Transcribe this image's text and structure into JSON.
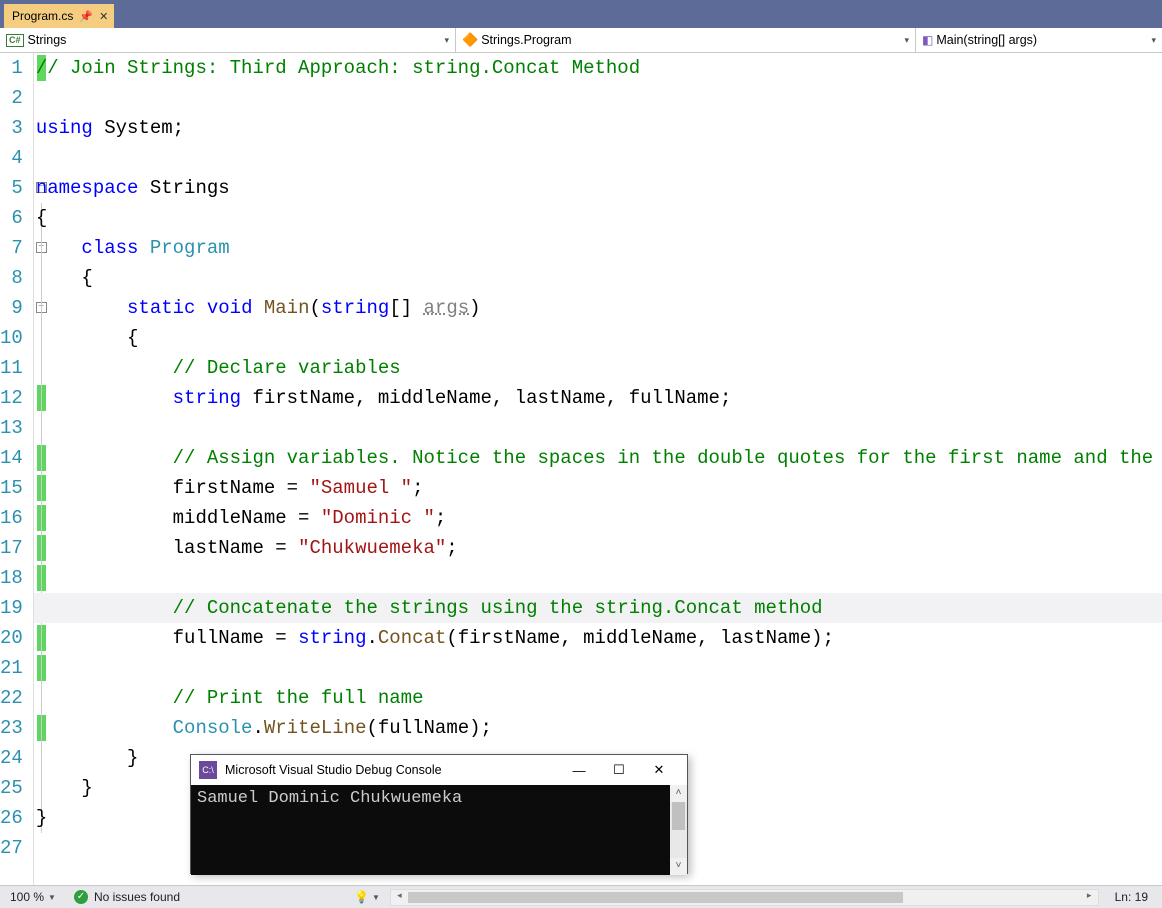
{
  "tab": {
    "name": "Program.cs"
  },
  "nav": {
    "scope": "Strings",
    "class": "Strings.Program",
    "method": "Main(string[] args)"
  },
  "code": {
    "lines": [
      {
        "n": 1,
        "indent": 0,
        "marker": true,
        "tokens": [
          [
            "c-comment",
            "// Join Strings: Third Approach: string.Concat Method"
          ]
        ]
      },
      {
        "n": 2,
        "indent": 0,
        "tokens": []
      },
      {
        "n": 3,
        "indent": 0,
        "tokens": [
          [
            "c-keyword",
            "using"
          ],
          [
            "",
            " System;"
          ]
        ]
      },
      {
        "n": 4,
        "indent": 0,
        "tokens": []
      },
      {
        "n": 5,
        "indent": 0,
        "fold": true,
        "tokens": [
          [
            "c-keyword",
            "namespace"
          ],
          [
            "",
            " Strings"
          ]
        ]
      },
      {
        "n": 6,
        "indent": 0,
        "tokens": [
          [
            "",
            "{"
          ]
        ]
      },
      {
        "n": 7,
        "indent": 1,
        "fold": true,
        "tokens": [
          [
            "c-keyword",
            "class"
          ],
          [
            "",
            " "
          ],
          [
            "c-type",
            "Program"
          ]
        ]
      },
      {
        "n": 8,
        "indent": 1,
        "tokens": [
          [
            "",
            "{"
          ]
        ]
      },
      {
        "n": 9,
        "indent": 2,
        "fold": true,
        "tokens": [
          [
            "c-keyword",
            "static"
          ],
          [
            "",
            " "
          ],
          [
            "c-keyword",
            "void"
          ],
          [
            "",
            " "
          ],
          [
            "c-method",
            "Main"
          ],
          [
            "",
            "("
          ],
          [
            "c-keyword",
            "string"
          ],
          [
            "",
            "[] "
          ],
          [
            "c-param",
            "args"
          ],
          [
            "",
            ")"
          ]
        ]
      },
      {
        "n": 10,
        "indent": 2,
        "tokens": [
          [
            "",
            "{"
          ]
        ]
      },
      {
        "n": 11,
        "indent": 3,
        "tokens": [
          [
            "c-comment",
            "// Declare variables"
          ]
        ]
      },
      {
        "n": 12,
        "indent": 3,
        "marker": true,
        "tokens": [
          [
            "c-keyword",
            "string"
          ],
          [
            "",
            " firstName, middleName, lastName, fullName;"
          ]
        ]
      },
      {
        "n": 13,
        "indent": 3,
        "tokens": []
      },
      {
        "n": 14,
        "indent": 3,
        "marker": true,
        "bigm": "s",
        "tokens": [
          [
            "c-comment",
            "// Assign variables. Notice the spaces in the double quotes for the first name and the middle name"
          ]
        ]
      },
      {
        "n": 15,
        "indent": 3,
        "marker": true,
        "tokens": [
          [
            "",
            "firstName = "
          ],
          [
            "c-string",
            "\"Samuel \""
          ],
          [
            "",
            ";"
          ]
        ]
      },
      {
        "n": 16,
        "indent": 3,
        "marker": true,
        "tokens": [
          [
            "",
            "middleName = "
          ],
          [
            "c-string",
            "\"Dominic \""
          ],
          [
            "",
            ";"
          ]
        ]
      },
      {
        "n": 17,
        "indent": 3,
        "marker": true,
        "tokens": [
          [
            "",
            "lastName = "
          ],
          [
            "c-string",
            "\"Chukwuemeka\""
          ],
          [
            "",
            ";"
          ]
        ]
      },
      {
        "n": 18,
        "indent": 3,
        "marker": true,
        "tokens": []
      },
      {
        "n": 19,
        "indent": 3,
        "marker": true,
        "hl": true,
        "tokens": [
          [
            "c-comment",
            "// Concatenate the strings using the string.Concat method"
          ]
        ]
      },
      {
        "n": 20,
        "indent": 3,
        "marker": true,
        "tokens": [
          [
            "",
            "fullName = "
          ],
          [
            "c-keyword",
            "string"
          ],
          [
            "",
            "."
          ],
          [
            "c-method",
            "Concat"
          ],
          [
            "",
            "(firstName, middleName, lastName);"
          ]
        ]
      },
      {
        "n": 21,
        "indent": 3,
        "marker": true,
        "bigm": "e",
        "tokens": []
      },
      {
        "n": 22,
        "indent": 3,
        "tokens": [
          [
            "c-comment",
            "// Print the full name"
          ]
        ]
      },
      {
        "n": 23,
        "indent": 3,
        "marker": true,
        "tokens": [
          [
            "c-type",
            "Console"
          ],
          [
            "",
            "."
          ],
          [
            "c-method",
            "WriteLine"
          ],
          [
            "",
            "(fullName);"
          ]
        ]
      },
      {
        "n": 24,
        "indent": 2,
        "tokens": [
          [
            "",
            "}"
          ]
        ]
      },
      {
        "n": 25,
        "indent": 1,
        "tokens": [
          [
            "",
            "}"
          ]
        ]
      },
      {
        "n": 26,
        "indent": 0,
        "tokens": [
          [
            "",
            "}"
          ]
        ]
      },
      {
        "n": 27,
        "indent": 0,
        "tokens": []
      }
    ]
  },
  "console": {
    "title": "Microsoft Visual Studio Debug Console",
    "output": "Samuel Dominic Chukwuemeka"
  },
  "status": {
    "zoom": "100 %",
    "issues": "No issues found",
    "line": "Ln: 19"
  }
}
